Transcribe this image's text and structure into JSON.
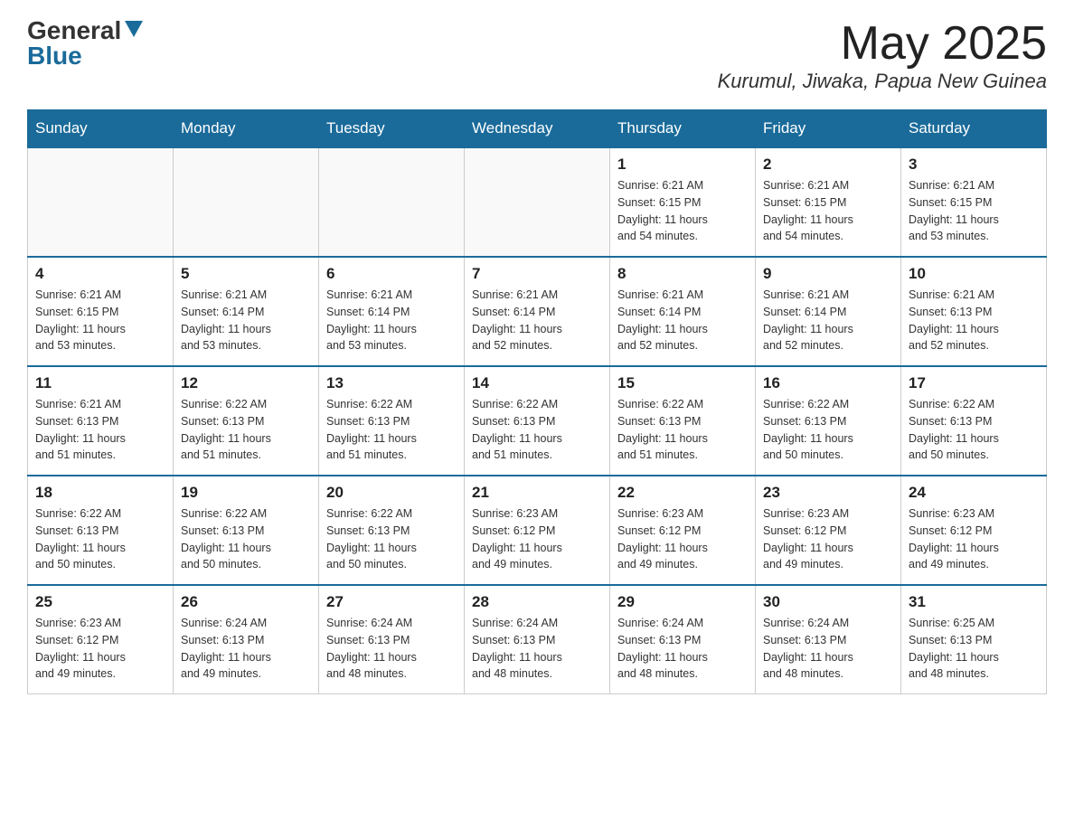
{
  "header": {
    "logo_general": "General",
    "logo_blue": "Blue",
    "month_year": "May 2025",
    "location": "Kurumul, Jiwaka, Papua New Guinea"
  },
  "days_of_week": [
    "Sunday",
    "Monday",
    "Tuesday",
    "Wednesday",
    "Thursday",
    "Friday",
    "Saturday"
  ],
  "weeks": [
    [
      {
        "day": "",
        "info": ""
      },
      {
        "day": "",
        "info": ""
      },
      {
        "day": "",
        "info": ""
      },
      {
        "day": "",
        "info": ""
      },
      {
        "day": "1",
        "info": "Sunrise: 6:21 AM\nSunset: 6:15 PM\nDaylight: 11 hours\nand 54 minutes."
      },
      {
        "day": "2",
        "info": "Sunrise: 6:21 AM\nSunset: 6:15 PM\nDaylight: 11 hours\nand 54 minutes."
      },
      {
        "day": "3",
        "info": "Sunrise: 6:21 AM\nSunset: 6:15 PM\nDaylight: 11 hours\nand 53 minutes."
      }
    ],
    [
      {
        "day": "4",
        "info": "Sunrise: 6:21 AM\nSunset: 6:15 PM\nDaylight: 11 hours\nand 53 minutes."
      },
      {
        "day": "5",
        "info": "Sunrise: 6:21 AM\nSunset: 6:14 PM\nDaylight: 11 hours\nand 53 minutes."
      },
      {
        "day": "6",
        "info": "Sunrise: 6:21 AM\nSunset: 6:14 PM\nDaylight: 11 hours\nand 53 minutes."
      },
      {
        "day": "7",
        "info": "Sunrise: 6:21 AM\nSunset: 6:14 PM\nDaylight: 11 hours\nand 52 minutes."
      },
      {
        "day": "8",
        "info": "Sunrise: 6:21 AM\nSunset: 6:14 PM\nDaylight: 11 hours\nand 52 minutes."
      },
      {
        "day": "9",
        "info": "Sunrise: 6:21 AM\nSunset: 6:14 PM\nDaylight: 11 hours\nand 52 minutes."
      },
      {
        "day": "10",
        "info": "Sunrise: 6:21 AM\nSunset: 6:13 PM\nDaylight: 11 hours\nand 52 minutes."
      }
    ],
    [
      {
        "day": "11",
        "info": "Sunrise: 6:21 AM\nSunset: 6:13 PM\nDaylight: 11 hours\nand 51 minutes."
      },
      {
        "day": "12",
        "info": "Sunrise: 6:22 AM\nSunset: 6:13 PM\nDaylight: 11 hours\nand 51 minutes."
      },
      {
        "day": "13",
        "info": "Sunrise: 6:22 AM\nSunset: 6:13 PM\nDaylight: 11 hours\nand 51 minutes."
      },
      {
        "day": "14",
        "info": "Sunrise: 6:22 AM\nSunset: 6:13 PM\nDaylight: 11 hours\nand 51 minutes."
      },
      {
        "day": "15",
        "info": "Sunrise: 6:22 AM\nSunset: 6:13 PM\nDaylight: 11 hours\nand 51 minutes."
      },
      {
        "day": "16",
        "info": "Sunrise: 6:22 AM\nSunset: 6:13 PM\nDaylight: 11 hours\nand 50 minutes."
      },
      {
        "day": "17",
        "info": "Sunrise: 6:22 AM\nSunset: 6:13 PM\nDaylight: 11 hours\nand 50 minutes."
      }
    ],
    [
      {
        "day": "18",
        "info": "Sunrise: 6:22 AM\nSunset: 6:13 PM\nDaylight: 11 hours\nand 50 minutes."
      },
      {
        "day": "19",
        "info": "Sunrise: 6:22 AM\nSunset: 6:13 PM\nDaylight: 11 hours\nand 50 minutes."
      },
      {
        "day": "20",
        "info": "Sunrise: 6:22 AM\nSunset: 6:13 PM\nDaylight: 11 hours\nand 50 minutes."
      },
      {
        "day": "21",
        "info": "Sunrise: 6:23 AM\nSunset: 6:12 PM\nDaylight: 11 hours\nand 49 minutes."
      },
      {
        "day": "22",
        "info": "Sunrise: 6:23 AM\nSunset: 6:12 PM\nDaylight: 11 hours\nand 49 minutes."
      },
      {
        "day": "23",
        "info": "Sunrise: 6:23 AM\nSunset: 6:12 PM\nDaylight: 11 hours\nand 49 minutes."
      },
      {
        "day": "24",
        "info": "Sunrise: 6:23 AM\nSunset: 6:12 PM\nDaylight: 11 hours\nand 49 minutes."
      }
    ],
    [
      {
        "day": "25",
        "info": "Sunrise: 6:23 AM\nSunset: 6:12 PM\nDaylight: 11 hours\nand 49 minutes."
      },
      {
        "day": "26",
        "info": "Sunrise: 6:24 AM\nSunset: 6:13 PM\nDaylight: 11 hours\nand 49 minutes."
      },
      {
        "day": "27",
        "info": "Sunrise: 6:24 AM\nSunset: 6:13 PM\nDaylight: 11 hours\nand 48 minutes."
      },
      {
        "day": "28",
        "info": "Sunrise: 6:24 AM\nSunset: 6:13 PM\nDaylight: 11 hours\nand 48 minutes."
      },
      {
        "day": "29",
        "info": "Sunrise: 6:24 AM\nSunset: 6:13 PM\nDaylight: 11 hours\nand 48 minutes."
      },
      {
        "day": "30",
        "info": "Sunrise: 6:24 AM\nSunset: 6:13 PM\nDaylight: 11 hours\nand 48 minutes."
      },
      {
        "day": "31",
        "info": "Sunrise: 6:25 AM\nSunset: 6:13 PM\nDaylight: 11 hours\nand 48 minutes."
      }
    ]
  ]
}
